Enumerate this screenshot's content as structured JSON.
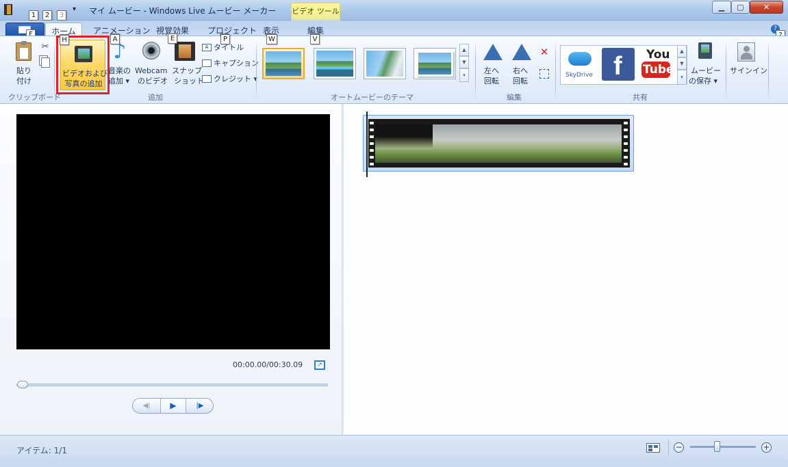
{
  "window": {
    "title": "マイ ムービー - Windows Live ムービー メーカー",
    "contextual_tab_group": "ビデオ ツール",
    "minimize_glyph": "▁",
    "maximize_glyph": "▢",
    "close_glyph": "✕"
  },
  "quick_access": {
    "keytips": [
      "1",
      "2",
      "3"
    ],
    "customize_glyph": "▾"
  },
  "tabs": [
    {
      "label": "ホーム",
      "keytip": "H"
    },
    {
      "label": "アニメーション",
      "keytip": "A"
    },
    {
      "label": "視覚効果",
      "keytip": "E"
    },
    {
      "label": "プロジェクト",
      "keytip": "P"
    },
    {
      "label": "表示",
      "keytip": "W"
    },
    {
      "label": "編集",
      "keytip": "V"
    }
  ],
  "file_tab_keytip": "F",
  "help_keytip": "?",
  "ribbon": {
    "clipboard": {
      "group_label": "クリップボード",
      "paste_label_1": "貼り",
      "paste_label_2": "付け"
    },
    "add": {
      "group_label": "追加",
      "add_video_photo_1": "ビデオおよび",
      "add_video_photo_2": "写真の追加",
      "add_music_1": "音楽の",
      "add_music_2": "追加 ▾",
      "webcam_1": "Webcam",
      "webcam_2": "のビデオ",
      "snapshot_1": "スナップ",
      "snapshot_2": "ショット",
      "title": "タイトル",
      "caption": "キャプション",
      "credits": "クレジット ▾"
    },
    "themes": {
      "group_label": "オートムービーのテーマ"
    },
    "edit": {
      "group_label": "編集",
      "rotate_left_1": "左へ",
      "rotate_left_2": "回転",
      "rotate_right_1": "右へ",
      "rotate_right_2": "回転"
    },
    "share": {
      "group_label": "共有",
      "skydrive": "SkyDrive",
      "facebook": "f",
      "youtube_top": "You",
      "youtube_bottom": "Tube",
      "save_movie_1": "ムービー",
      "save_movie_2": "の保存 ▾",
      "sign_in": "サインイン"
    }
  },
  "preview": {
    "time": "00:00.00/00:30.09",
    "fullscreen_glyph": "↗",
    "prev_frame_glyph": "◀|",
    "play_glyph": "▶",
    "next_frame_glyph": "|▶"
  },
  "status": {
    "items": "アイテム: 1/1",
    "zoom_out": "−",
    "zoom_in": "+",
    "zoom_level": 0.4
  },
  "colors": {
    "highlight_box": "#e0202b",
    "accent": "#2f7fd1",
    "contextual_yellow": "#f4f093"
  }
}
